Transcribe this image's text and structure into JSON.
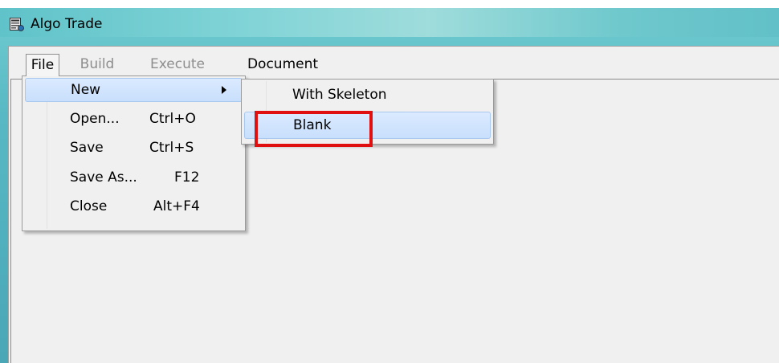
{
  "window": {
    "title": "Algo Trade",
    "icon": "app-window-icon"
  },
  "menubar": {
    "file": "File",
    "build": "Build",
    "execute": "Execute",
    "document": "Document"
  },
  "file_menu": {
    "items": [
      {
        "label": "New",
        "shortcut": "",
        "has_submenu": true,
        "state": "highlighted"
      },
      {
        "label": "Open...",
        "shortcut": "Ctrl+O"
      },
      {
        "label": "Save",
        "shortcut": "Ctrl+S"
      },
      {
        "label": "Save As...",
        "shortcut": "F12"
      },
      {
        "label": "Close",
        "shortcut": "Alt+F4"
      }
    ]
  },
  "new_submenu": {
    "items": [
      {
        "label": "With Skeleton"
      },
      {
        "label": "Blank",
        "state": "highlighted"
      }
    ]
  },
  "annotation": {
    "color": "#e01010",
    "target": "Blank"
  },
  "colors": {
    "titlebar": "#6ec8cc",
    "menu_highlight": "#cce0fb",
    "disabled_text": "#8d8d8d"
  }
}
